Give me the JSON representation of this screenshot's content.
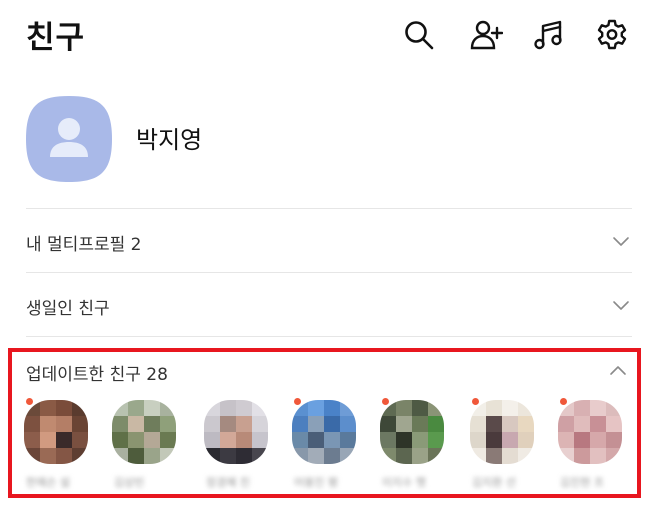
{
  "header": {
    "title": "친구",
    "icons": [
      "search-icon",
      "add-friend-icon",
      "music-icon",
      "settings-icon"
    ]
  },
  "profile": {
    "name": "박지영"
  },
  "sections": {
    "multi_profile": {
      "label": "내 멀티프로필 2",
      "state": "collapsed"
    },
    "birthday": {
      "label": "생일인 친구",
      "state": "collapsed"
    },
    "updated": {
      "label": "업데이트한 친구 28",
      "state": "expanded",
      "friends": [
        {
          "name": "한예슨 설",
          "new": true
        },
        {
          "name": "김상빈",
          "new": false
        },
        {
          "name": "정경혜 친",
          "new": false
        },
        {
          "name": "어붕진 평",
          "new": true
        },
        {
          "name": "이지수 햇",
          "new": true
        },
        {
          "name": "김지환 선",
          "new": true
        },
        {
          "name": "김진현 프",
          "new": true
        }
      ]
    }
  },
  "colors": {
    "highlight_border": "#e8161f",
    "new_dot": "#f0583a",
    "avatar_bg": "#a9b9e8"
  }
}
